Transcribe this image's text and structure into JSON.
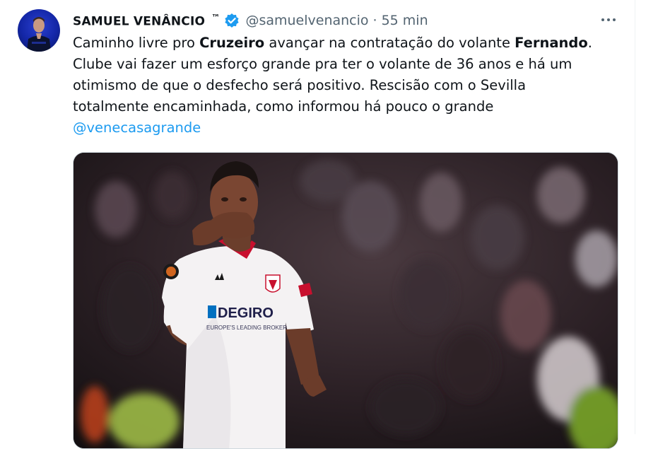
{
  "tweet": {
    "author_name": "SAMUEL VENÂNCIO",
    "author_suffix": "™",
    "handle": "@samuelvenancio",
    "separator": "·",
    "time": "55 min",
    "text": {
      "l1_a": "Caminho livre pro ",
      "l1_b": "Cruzeiro",
      "l1_c": " avançar na contratação do volante ",
      "l1_d": "Fernando",
      "l1_e": ".",
      "l2": "Clube vai fazer um esforço grande pra ter o volante de 36 anos e há um",
      "l3": "otimismo de que o desfecho será positivo. Rescisão com o Sevilla",
      "l4": "totalmente encaminhada, como informou há pouco o grande",
      "mention": "@venecasagrande"
    },
    "media": {
      "sponsor": "DEGIRO",
      "sponsor_tagline": "EUROPE'S LEADING BROKER"
    }
  },
  "colors": {
    "text": "#0f1419",
    "secondary": "#536471",
    "link": "#1d9bf0",
    "verified": "#1d9bf0",
    "avatar_bg": "#1326a6"
  },
  "icons": {
    "verified": "verified-badge-icon",
    "more": "more-options-icon"
  }
}
